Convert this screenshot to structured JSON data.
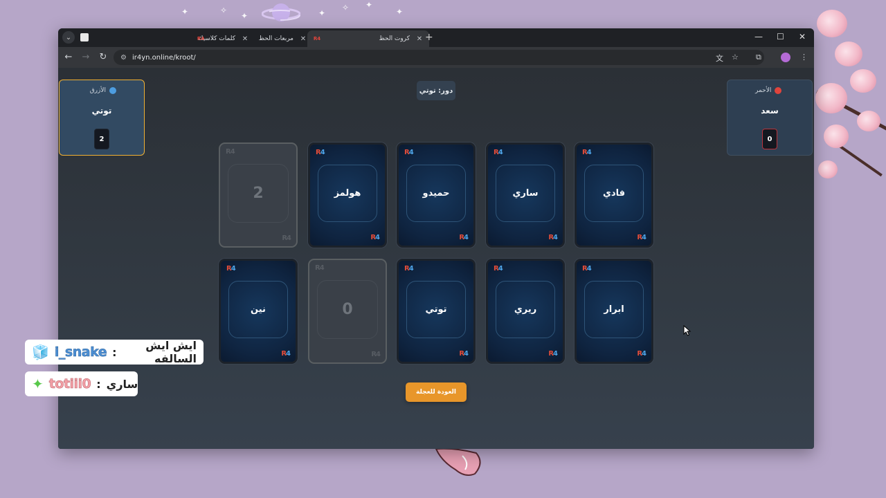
{
  "browser": {
    "tabs": [
      {
        "title": "كلمات كلاسيك",
        "favicon": "square-icon",
        "active": false
      },
      {
        "title": "مربعات الحظ",
        "favicon": "R4",
        "active": false
      },
      {
        "title": "كروت الحظ",
        "favicon": "R4",
        "active": true
      }
    ],
    "url": "ir4yn.online/kroot/",
    "favicon_text": "R4"
  },
  "game": {
    "turn_label": "دور: توتي",
    "blue_team": {
      "name": "الأزرق",
      "player": "توتي",
      "score": "2",
      "color": "#4d9de0"
    },
    "red_team": {
      "name": "الأحمر",
      "player": "سعد",
      "score": "0",
      "color": "#e0443c"
    },
    "card_logo": {
      "r": "R",
      "n": "4"
    },
    "cards_row1": [
      {
        "text": "2",
        "revealed": true
      },
      {
        "text": "هولمز",
        "revealed": false
      },
      {
        "text": "حميدو",
        "revealed": false
      },
      {
        "text": "ساري",
        "revealed": false
      },
      {
        "text": "فادي",
        "revealed": false
      }
    ],
    "cards_row2": [
      {
        "text": "نين",
        "revealed": false
      },
      {
        "text": "0",
        "revealed": true
      },
      {
        "text": "توتي",
        "revealed": false
      },
      {
        "text": "ريري",
        "revealed": false
      },
      {
        "text": "ابرار",
        "revealed": false
      }
    ],
    "back_button": "العودة للعجلة"
  },
  "chat": [
    {
      "user": "i_snake",
      "separator": ":",
      "message": "ايش ايش السالفه",
      "icon": "blue-cube-icon"
    },
    {
      "user": "totiii0",
      "separator": ":",
      "message": "ساري",
      "icon": "green-sparkle-icon"
    }
  ]
}
